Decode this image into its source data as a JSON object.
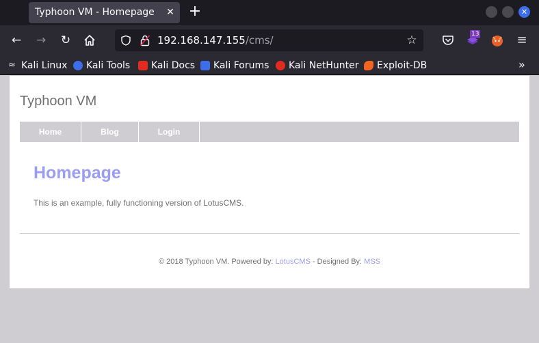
{
  "browser": {
    "tab_title": "Typhoon VM - Homepage",
    "tab_close": "✕",
    "new_tab": "+",
    "window_close": "✕",
    "url_host": "192.168.147.155",
    "url_path": "/cms/",
    "extension_badge": "13",
    "menu_glyph": "≡",
    "back_glyph": "←",
    "forward_glyph": "→",
    "reload_glyph": "↻",
    "star_glyph": "☆",
    "bookmarks": [
      {
        "label": "Kali Linux",
        "icon": "kali-dragon-icon",
        "color": "#1c1b22"
      },
      {
        "label": "Kali Tools",
        "icon": "kali-tools-icon",
        "color": "#3d6eea"
      },
      {
        "label": "Kali Docs",
        "icon": "kali-docs-icon",
        "color": "#e02b20"
      },
      {
        "label": "Kali Forums",
        "icon": "kali-forums-icon",
        "color": "#3d6eea"
      },
      {
        "label": "Kali NetHunter",
        "icon": "nethunter-icon",
        "color": "#e02b20"
      },
      {
        "label": "Exploit-DB",
        "icon": "exploit-db-icon",
        "color": "#f26422"
      }
    ],
    "more_glyph": "»"
  },
  "site": {
    "title": "Typhoon VM",
    "nav": [
      "Home",
      "Blog",
      "Login"
    ],
    "heading": "Homepage",
    "body": "This is an example, fully functioning version of LotusCMS.",
    "footer_prefix": "© 2018 Typhoon VM. Powered by: ",
    "footer_link1": "LotusCMS",
    "footer_middle": " - Designed By: ",
    "footer_link2": "MSS"
  },
  "colors": {
    "accent": "#9b9df0",
    "menu_bg": "#cfcdd1",
    "chrome_dark": "#1c1b22",
    "chrome_toolbar": "#2b2a33"
  }
}
